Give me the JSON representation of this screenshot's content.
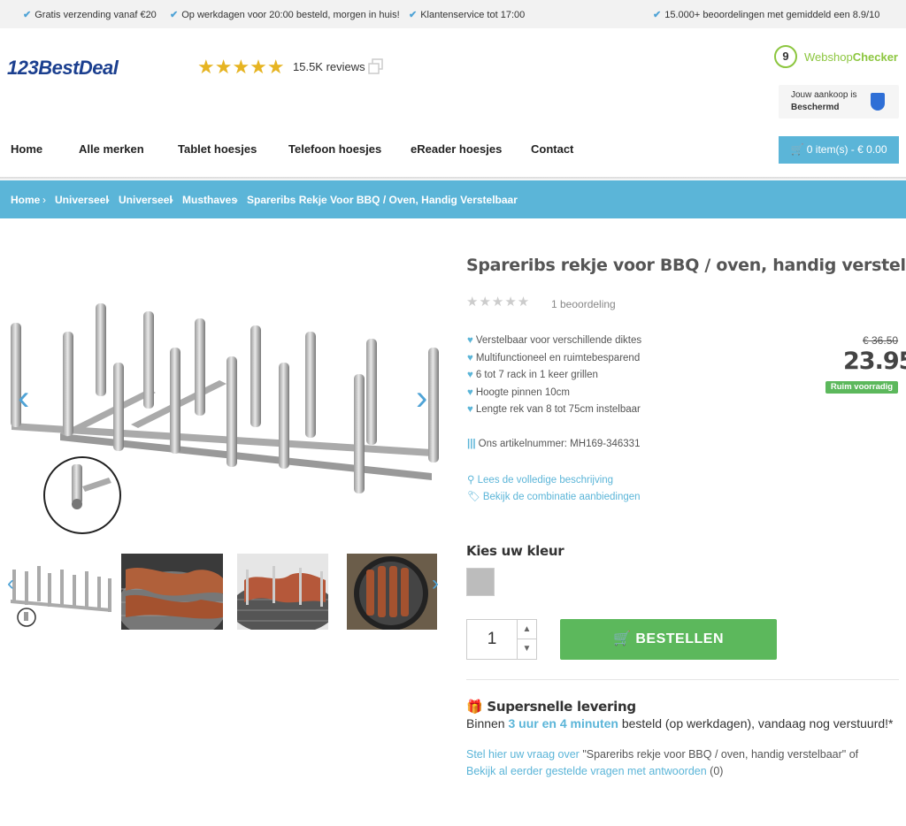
{
  "usp_bar": {
    "items": [
      "Gratis verzending vanaf €20",
      "Op werkdagen voor 20:00 besteld, morgen in huis!",
      "Klantenservice tot 17:00",
      "15.000+ beoordelingen met gemiddeld een 8.9/10"
    ]
  },
  "header": {
    "logo": "123BestDeal",
    "rating_stars": "★★★★★",
    "rating_value": 4.5,
    "reviews": "15.5K reviews",
    "wsc_score": "9",
    "wsc_name_a": "Webshop",
    "wsc_name_b": "Checker",
    "protect_line1": "Jouw aankoop is",
    "protect_line2": "Beschermd"
  },
  "nav": {
    "items": [
      "Home",
      "Alle merken",
      "Tablet hoesjes",
      "Telefoon hoesjes",
      "eReader hoesjes",
      "Contact"
    ],
    "cart": "0 item(s) - € 0.00"
  },
  "breadcrumb": [
    "Home",
    "Universeel",
    "Universeel",
    "Musthaves",
    "Spareribs Rekje Voor BBQ / Oven, Handig Verstelbaar"
  ],
  "product": {
    "title": "Spareribs rekje voor BBQ / oven, handig verstelbaar",
    "review_stars": "★★★★★",
    "review_count": "1 beoordeling",
    "features": [
      "Verstelbaar voor verschillende diktes",
      "Multifunctioneel en ruimtebesparend",
      "6 tot 7 rack in 1 keer grillen",
      "Hoogte pinnen 10cm",
      "Lengte rek van 8 tot 75cm instelbaar"
    ],
    "old_price": "€ 36.50",
    "price": "23.95",
    "stock": "Ruim voorradig",
    "article": "Ons artikelnummer: MH169-346331",
    "link_desc": "Lees de volledige beschrijving",
    "link_combo": "Bekijk de combinatie aanbiedingen",
    "color_label": "Kies uw kleur",
    "color_swatch": "#bcbcbc",
    "qty": "1",
    "order_label": "BESTELLEN"
  },
  "shipping": {
    "heading": "Supersnelle levering",
    "pre": "Binnen ",
    "highlight": "3 uur en 4 minuten",
    "post": " besteld (op werkdagen), vandaag nog verstuurd!*"
  },
  "questions": {
    "ask_link": "Stel hier uw vraag over",
    "ask_rest": " \"Spareribs rekje voor BBQ / oven, handig verstelbaar\" of",
    "view_link": "Bekijk al eerder gestelde vragen met antwoorden",
    "view_count": " (0)"
  }
}
